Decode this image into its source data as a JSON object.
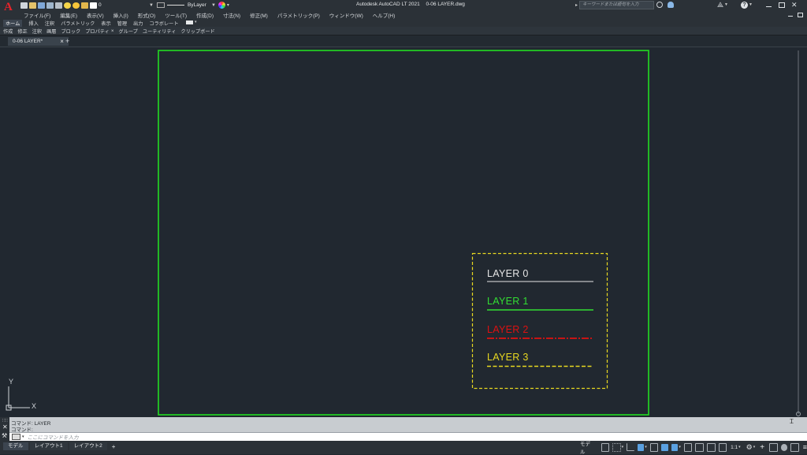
{
  "app": {
    "title": "Autodesk AutoCAD LT 2021",
    "filename": "0-06 LAYER.dwg",
    "logo_letter": "A"
  },
  "quick_access": {
    "layer_value": "0",
    "linetype_value": "ByLayer",
    "search_placeholder": "キーワードまたは語句を入力"
  },
  "menu": [
    "ファイル(F)",
    "編集(E)",
    "表示(V)",
    "挿入(I)",
    "形式(O)",
    "ツール(T)",
    "作成(D)",
    "寸法(N)",
    "修正(M)",
    "パラメトリック(P)",
    "ウィンドウ(W)",
    "ヘルプ(H)"
  ],
  "ribbon_tabs": [
    "ホーム",
    "挿入",
    "注釈",
    "パラメトリック",
    "表示",
    "管理",
    "出力",
    "コラボレート"
  ],
  "ribbon_panels": [
    "作成",
    "修正",
    "注釈",
    "画層",
    "ブロック",
    "プロパティ",
    "グループ",
    "ユーティリティ",
    "クリップボード"
  ],
  "doc_tab": {
    "label": "0-06 LAYER*",
    "close": "×",
    "add": "+"
  },
  "ucs": {
    "x": "X",
    "y": "Y"
  },
  "legend": {
    "items": [
      {
        "label": "LAYER 0",
        "color": "#e6e6e6",
        "line": "solid"
      },
      {
        "label": "LAYER 1",
        "color": "#33dd33",
        "line": "solid"
      },
      {
        "label": "LAYER 2",
        "color": "#dd1111",
        "line": "dashdot"
      },
      {
        "label": "LAYER 3",
        "color": "#e8d820",
        "line": "dashed"
      }
    ],
    "frame_color": "#e8d820"
  },
  "drawing": {
    "border_color": "#22dd22",
    "background": "#212830"
  },
  "command": {
    "history_1": "コマンド:  LAYER",
    "history_2": "コマンド:",
    "placeholder": "ここにコマンドを入力"
  },
  "status": {
    "tabs": [
      "モデル",
      "レイアウト1",
      "レイアウト2"
    ],
    "add": "+",
    "model_label": "モデル",
    "scale": "1:1"
  }
}
